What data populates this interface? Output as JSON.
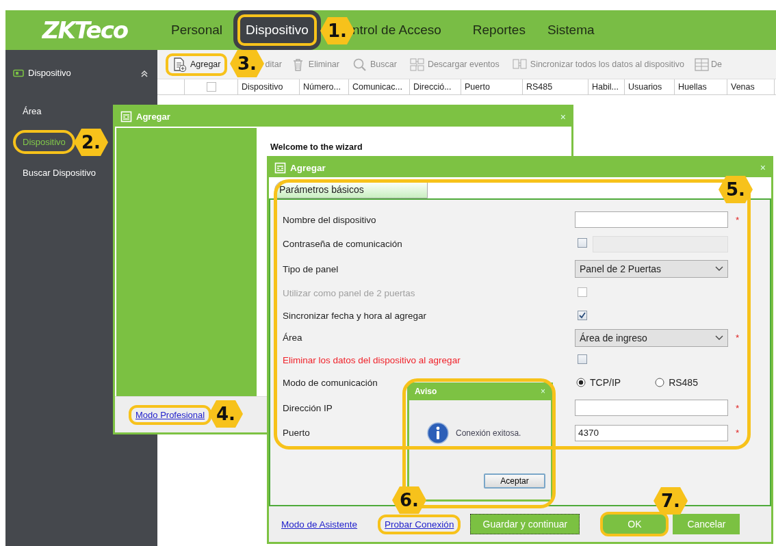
{
  "header": {
    "logo": "ZKTeco",
    "menu": [
      {
        "label": "Personal",
        "selected": false,
        "highlighted": false
      },
      {
        "label": "Dispositivo",
        "selected": true,
        "highlighted": true
      },
      {
        "label": "ntrol de Acceso",
        "selected": false,
        "highlighted": false
      },
      {
        "label": "Reportes",
        "selected": false,
        "highlighted": false
      },
      {
        "label": "Sistema",
        "selected": false,
        "highlighted": false
      }
    ]
  },
  "sidebar": {
    "title": "Dispositivo",
    "expanded": true,
    "items": [
      {
        "label": "Área",
        "selected": false,
        "highlighted": false
      },
      {
        "label": "Dispositivo",
        "selected": true,
        "highlighted": true
      },
      {
        "label": "Buscar Dispositivo",
        "selected": false,
        "highlighted": false
      }
    ]
  },
  "toolbar": [
    {
      "kind": "add",
      "label": "Agregar",
      "disabled": false,
      "highlighted": true
    },
    {
      "kind": "edit",
      "label": "ditar",
      "disabled": true,
      "highlighted": false
    },
    {
      "kind": "delete",
      "label": "Eliminar",
      "disabled": true,
      "highlighted": false
    },
    {
      "kind": "search",
      "label": "Buscar",
      "disabled": true,
      "highlighted": false
    },
    {
      "kind": "download",
      "label": "Descargar eventos",
      "disabled": true,
      "highlighted": false
    },
    {
      "kind": "sync",
      "label": "Sincronizar todos los datos al dispositivo",
      "disabled": true,
      "highlighted": false
    },
    {
      "kind": "grid",
      "label": "De",
      "disabled": true,
      "highlighted": false
    }
  ],
  "table": {
    "select_all": {
      "checked": false
    },
    "columns": [
      "Dispositivo",
      "Número...",
      "Comunicac...",
      "Direcció...",
      "Puerto",
      "RS485",
      "Habil...",
      "Usuarios",
      "Huellas",
      "Venas"
    ]
  },
  "wizard": {
    "title": "Agregar",
    "close": "×",
    "heading": "Welcome to the wizard",
    "link": {
      "label": "Modo Profesional",
      "highlighted": true
    }
  },
  "device_dialog": {
    "title": "Agregar",
    "close": "×",
    "highlighted": true,
    "tabs": [
      {
        "label": "Parámetros básicos",
        "selected": true
      }
    ],
    "rows": [
      {
        "kind": "text",
        "label": "Nombre del dispositivo",
        "disabled": false,
        "warning": false,
        "marker": "*"
      },
      {
        "kind": "password",
        "label": "Contraseña de comunicación",
        "disabled": false,
        "warning": false,
        "checked": false
      },
      {
        "kind": "select",
        "label": "Tipo de panel",
        "disabled": false,
        "warning": false,
        "value": "Panel de 2 Puertas"
      },
      {
        "kind": "checkbox",
        "label": "Utilizar como panel de 2 puertas",
        "disabled": true,
        "warning": false,
        "checked": false
      },
      {
        "kind": "checkbox",
        "label": "Sincronizar fecha y hora al agregar",
        "disabled": false,
        "warning": false,
        "checked": true
      },
      {
        "kind": "select",
        "label": "Área",
        "disabled": false,
        "warning": false,
        "value": "Área de ingreso",
        "marker": "*"
      },
      {
        "kind": "checkbox",
        "label": "Eliminar los datos del dispositivo al agregar",
        "disabled": false,
        "warning": true,
        "checked": false
      },
      {
        "kind": "radio",
        "label": "Modo de comunicación",
        "disabled": false,
        "warning": false,
        "options": [
          {
            "label": "TCP/IP",
            "selected": true
          },
          {
            "label": "RS485",
            "selected": false
          }
        ]
      },
      {
        "kind": "text",
        "label": "Dirección IP",
        "disabled": false,
        "warning": false,
        "marker": "*"
      },
      {
        "kind": "text",
        "label": "Puerto",
        "disabled": false,
        "warning": false,
        "value": "4370",
        "marker": "*"
      }
    ],
    "links": [
      {
        "label": "Modo de Asistente",
        "highlighted": false
      },
      {
        "label": "Probar Conexión",
        "highlighted": true
      }
    ],
    "buttons": [
      {
        "label": "Guardar y continuar",
        "focused": true,
        "highlighted": false
      },
      {
        "label": "OK",
        "focused": false,
        "highlighted": true
      },
      {
        "label": "Cancelar",
        "focused": false,
        "highlighted": false
      }
    ]
  },
  "alert": {
    "title": "Aviso",
    "close": "×",
    "message": "Conexión exitosa.",
    "button": "Aceptar",
    "highlighted": true
  },
  "annotations": [
    {
      "label": "1."
    },
    {
      "label": "2."
    },
    {
      "label": "3."
    },
    {
      "label": "4."
    },
    {
      "label": "5."
    },
    {
      "label": "6."
    },
    {
      "label": "7."
    }
  ]
}
